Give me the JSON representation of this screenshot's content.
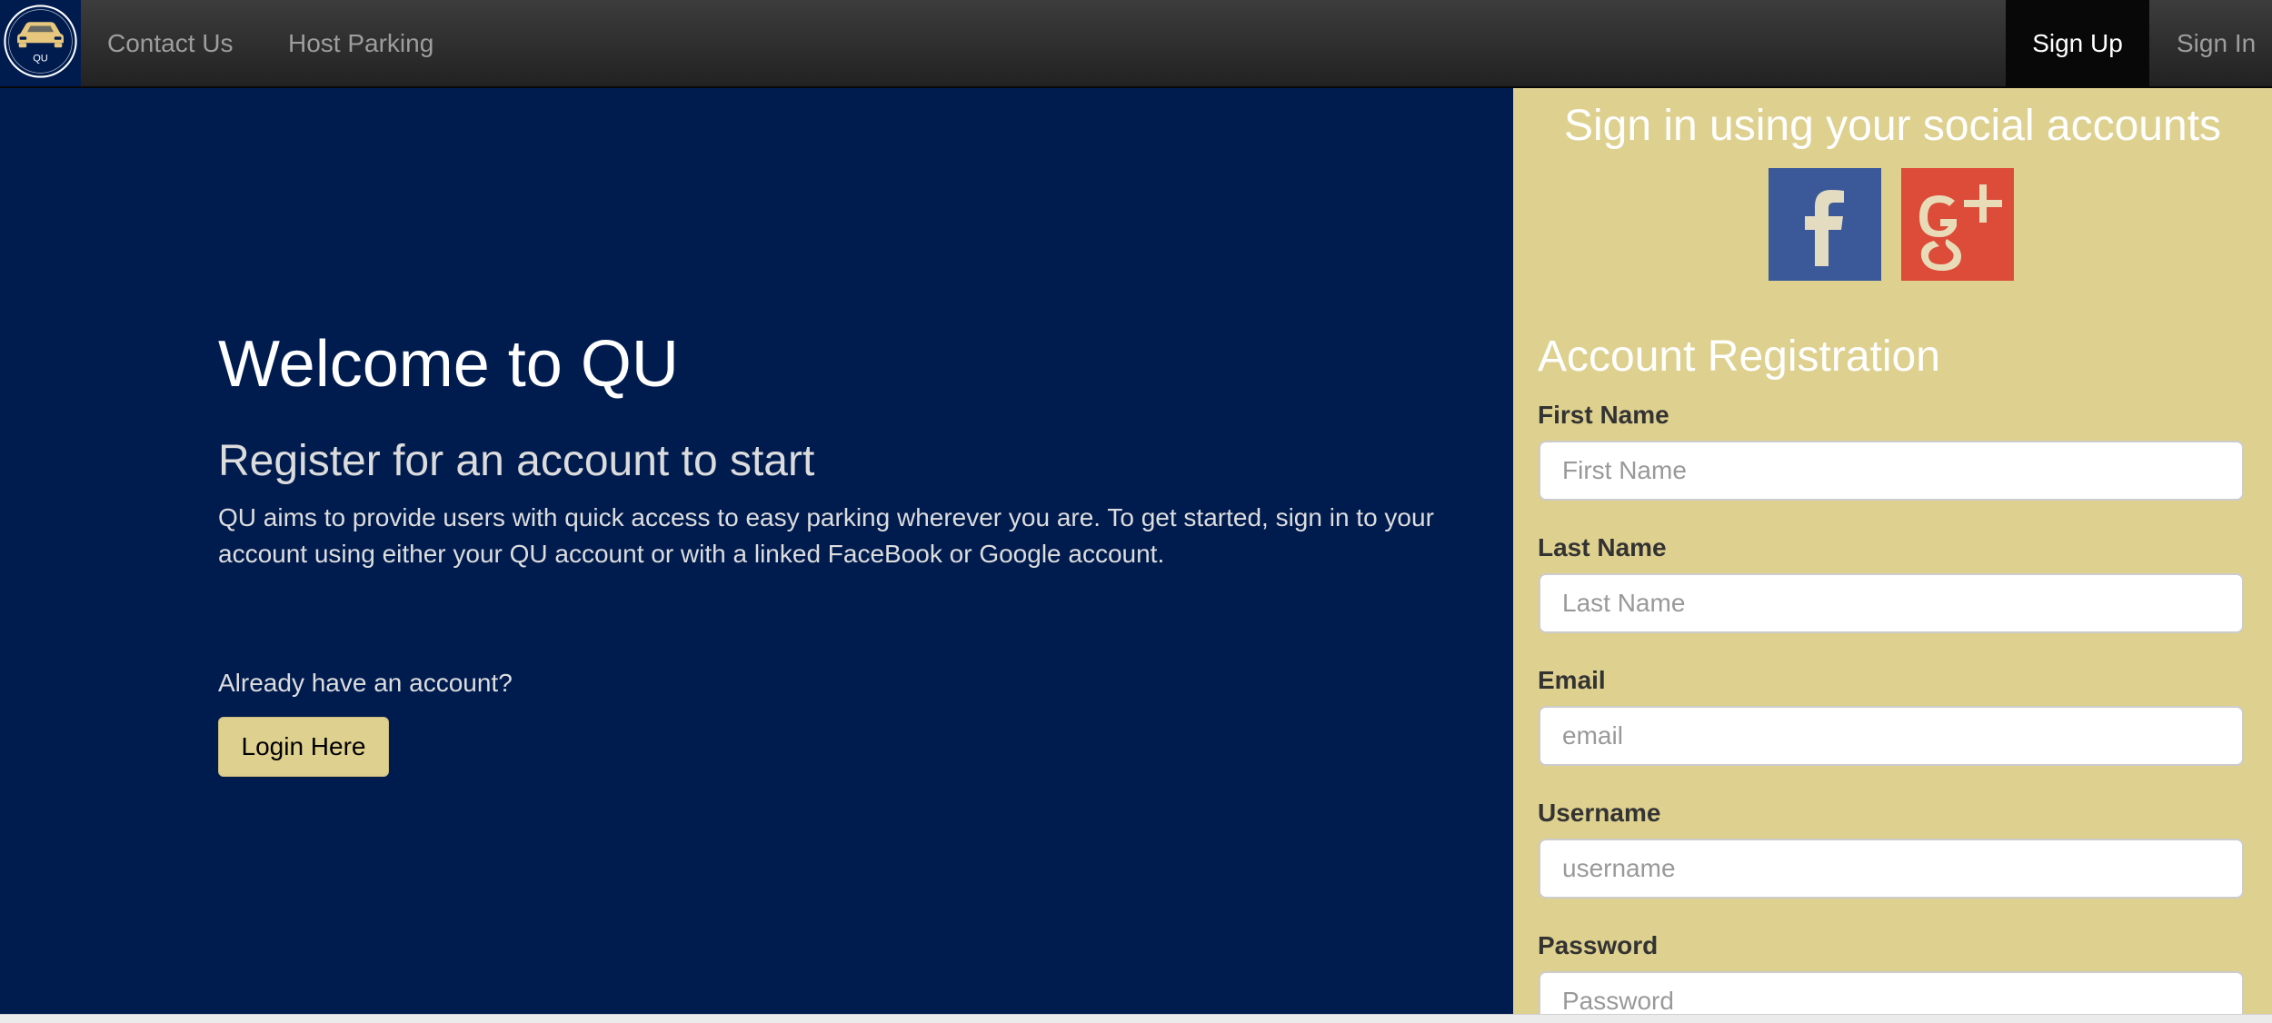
{
  "nav": {
    "brand_text": "QU",
    "contact_label": "Contact Us",
    "host_label": "Host Parking",
    "signup_label": "Sign Up",
    "signin_label": "Sign In"
  },
  "hero": {
    "title": "Welcome to QU",
    "subtitle": "Register for an account to start",
    "description": "QU aims to provide users with quick access to easy parking wherever you are. To get started, sign in to your account using either your QU account or with a linked FaceBook or Google account.",
    "already_text": "Already have an account?",
    "login_button": "Login Here"
  },
  "social": {
    "title": "Sign in using your social accounts",
    "facebook_icon": "facebook-icon",
    "google_icon": "google-plus-icon",
    "facebook_color": "#3b5998",
    "google_color": "#dd4b39"
  },
  "registration": {
    "title": "Account Registration",
    "fields": [
      {
        "label": "First Name",
        "placeholder": "First Name",
        "value": ""
      },
      {
        "label": "Last Name",
        "placeholder": "Last Name",
        "value": ""
      },
      {
        "label": "Email",
        "placeholder": "email",
        "value": ""
      },
      {
        "label": "Username",
        "placeholder": "username",
        "value": ""
      },
      {
        "label": "Password",
        "placeholder": "Password",
        "value": ""
      }
    ]
  },
  "colors": {
    "navy": "#001c4f",
    "gold": "#ded08e",
    "nav_dark": "#222222"
  }
}
